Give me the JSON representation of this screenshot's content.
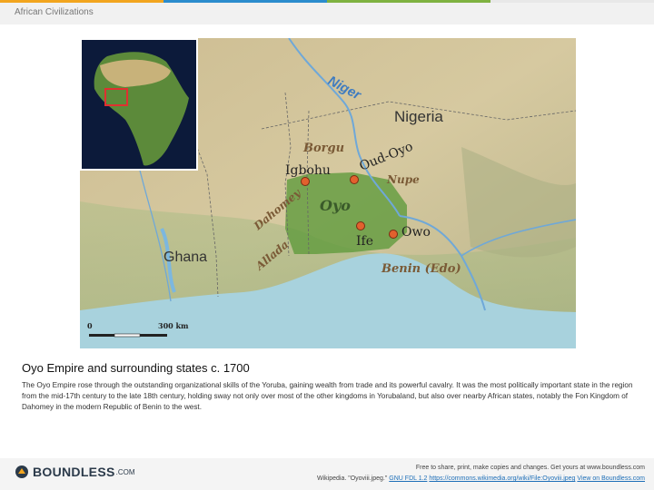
{
  "header": {
    "title": "African Civilizations"
  },
  "brand": {
    "colors": [
      "#f2a51f",
      "#2b8ccd",
      "#7fb241",
      "#f0f0f0"
    ]
  },
  "map": {
    "labels": {
      "river": "Niger",
      "country_nigeria": "Nigeria",
      "borgu": "Borgu",
      "oud_oyo": "Oud-Oyo",
      "igbohu": "Igbohu",
      "nupe": "Nupe",
      "oyo": "Oyo",
      "dahomey": "Dahomey",
      "ife": "Ife",
      "owo": "Owo",
      "allada": "Allada",
      "ghana": "Ghana",
      "benin": "Benin (Edo)",
      "scale_zero": "0",
      "scale_300": "300 km"
    }
  },
  "caption": {
    "title": "Oyo Empire and surrounding states c. 1700",
    "body": "The Oyo Empire rose through the outstanding organizational skills of the Yoruba, gaining wealth from trade and its powerful cavalry. It was the most politically important state in the region from the mid-17th century to the late 18th century, holding sway not only over most of the other kingdoms in Yorubaland, but also over nearby African states, notably the Fon Kingdom of Dahomey in the modern Republic of Benin to the west."
  },
  "footer": {
    "logo_text": "BOUNDLESS",
    "logo_domain": ".COM",
    "share_text": "Free to share, print, make copies and changes. Get yours at www.boundless.com",
    "attribution_prefix": "Wikipedia. \"Oyoviii.jpeg.\"",
    "license_link": "GNU FDL 1.2",
    "source_link": "https://commons.wikimedia.org/wiki/File:Oyoviii.jpeg",
    "view_link": "View on Boundless.com"
  }
}
